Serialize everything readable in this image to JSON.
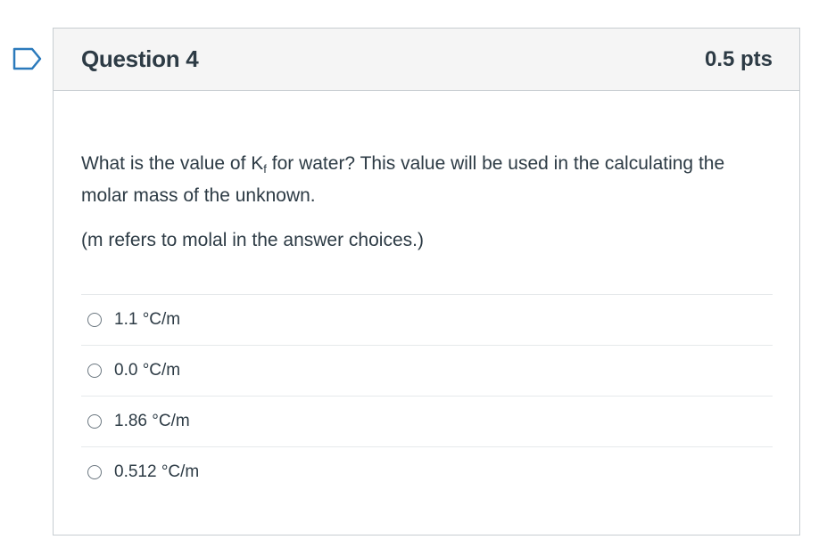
{
  "question": {
    "title": "Question 4",
    "points": "0.5 pts",
    "text_before_k": "What is the value of K",
    "k_subscript": "f",
    "text_after_k": " for water?  This value will be used in the calculating the molar mass of the unknown.",
    "note": "(m refers to molal in the answer choices.)",
    "answers": [
      {
        "label": "1.1 °C/m",
        "selected": false
      },
      {
        "label": "0.0 °C/m",
        "selected": false
      },
      {
        "label": "1.86 °C/m",
        "selected": false
      },
      {
        "label": "0.512 °C/m",
        "selected": false
      }
    ]
  },
  "colors": {
    "flag_outline": "#2b7abc",
    "header_bg": "#f5f5f5",
    "border": "#c7cdd1",
    "text": "#2d3b45"
  },
  "icons": {
    "flag": "flag-question-icon",
    "radio": "radio-unselected-icon"
  }
}
